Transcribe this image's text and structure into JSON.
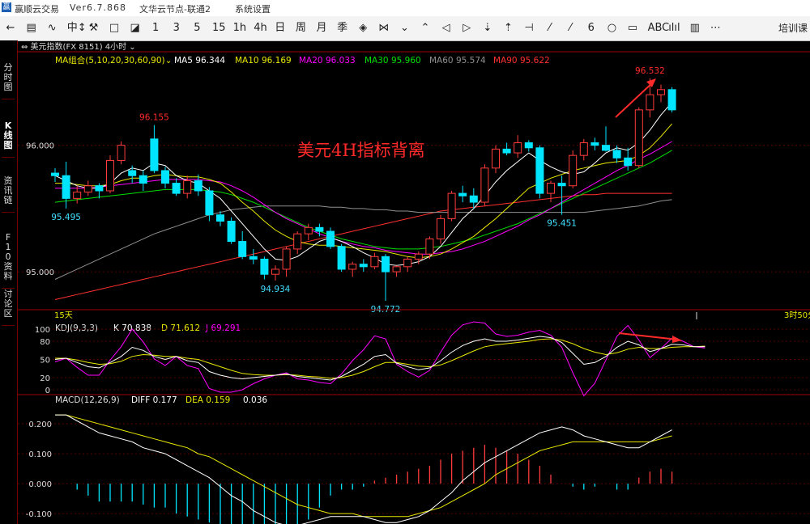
{
  "titlebar": {
    "app": "赢顺云交易",
    "version": "Ver6.7.868",
    "node": "文华云节点-联通2",
    "section": "系统设置"
  },
  "toolbar": {
    "items": [
      "←",
      "▤",
      "∿",
      "中↕",
      "⚒",
      "□",
      "◪",
      "1",
      "3",
      "5",
      "15",
      "1h",
      "4h",
      "日",
      "周",
      "月",
      "季",
      "◈",
      "⋈",
      "⌄",
      "⌃",
      "◁",
      "▷",
      "⇣",
      "⇡",
      "⊣",
      "⁄",
      "⁄",
      "6",
      "○",
      "▭",
      "ABC",
      "ılıl",
      "▥",
      "⋯"
    ],
    "training": "培训课"
  },
  "sidebar": {
    "tabs": [
      {
        "label": "分时图",
        "active": false
      },
      {
        "label": "K线图",
        "active": true
      },
      {
        "label": "资讯链",
        "active": false
      },
      {
        "label": "F10资料",
        "active": false
      },
      {
        "label": "讨论区",
        "active": false
      }
    ]
  },
  "colors": {
    "up": "#ff3c3c",
    "down": "#00e5ff",
    "ma5": "#ffffff",
    "ma10": "#e8e800",
    "ma20": "#ff00ff",
    "ma30": "#00e000",
    "ma60": "#909090",
    "ma90": "#ff3030",
    "k": "#ffffff",
    "d": "#e8e800",
    "j": "#ff00ff",
    "annotation": "#ff2a2a",
    "axis": "#a00000"
  },
  "chart_data": [
    {
      "type": "candlestick",
      "symbol_header": "美元指数(FX 8151)  4小时",
      "indicator_header": "MA组合(5,10,20,30,60,90)",
      "ma_legend": [
        {
          "name": "MA5",
          "value": "96.344"
        },
        {
          "name": "MA10",
          "value": "96.169"
        },
        {
          "name": "MA20",
          "value": "96.033"
        },
        {
          "name": "MA30",
          "value": "95.960"
        },
        {
          "name": "MA60",
          "value": "95.574"
        },
        {
          "name": "MA90",
          "value": "95.622"
        }
      ],
      "annotation": "美元4H指标背离",
      "y_ticks": [
        96.0,
        95.0
      ],
      "ylim": [
        94.7,
        96.65
      ],
      "price_labels": [
        {
          "text": "96.532",
          "index": 54
        },
        {
          "text": "96.155",
          "index": 9
        },
        {
          "text": "95.495",
          "index": 1
        },
        {
          "text": "94.934",
          "index": 20
        },
        {
          "text": "94.772",
          "index": 30
        },
        {
          "text": "95.451",
          "index": 46
        }
      ],
      "footer_left": "15天",
      "footer_right": "3时50分",
      "candles": [
        [
          95.78,
          95.82,
          95.71,
          95.76
        ],
        [
          95.76,
          95.87,
          95.5,
          95.58
        ],
        [
          95.58,
          95.68,
          95.54,
          95.63
        ],
        [
          95.63,
          95.72,
          95.6,
          95.68
        ],
        [
          95.68,
          95.7,
          95.58,
          95.64
        ],
        [
          95.64,
          95.92,
          95.62,
          95.88
        ],
        [
          95.88,
          96.03,
          95.85,
          96.0
        ],
        [
          95.8,
          95.84,
          95.7,
          95.76
        ],
        [
          95.76,
          95.8,
          95.64,
          95.7
        ],
        [
          96.05,
          96.16,
          95.78,
          95.8
        ],
        [
          95.8,
          95.83,
          95.66,
          95.7
        ],
        [
          95.7,
          95.74,
          95.6,
          95.62
        ],
        [
          95.62,
          95.76,
          95.58,
          95.72
        ],
        [
          95.72,
          95.77,
          95.6,
          95.64
        ],
        [
          95.64,
          95.67,
          95.4,
          95.45
        ],
        [
          95.45,
          95.48,
          95.36,
          95.4
        ],
        [
          95.4,
          95.43,
          95.22,
          95.24
        ],
        [
          95.24,
          95.32,
          95.1,
          95.12
        ],
        [
          95.12,
          95.18,
          95.06,
          95.1
        ],
        [
          95.1,
          95.12,
          94.94,
          94.98
        ],
        [
          94.98,
          95.05,
          94.93,
          95.02
        ],
        [
          95.02,
          95.2,
          94.96,
          95.18
        ],
        [
          95.18,
          95.32,
          95.14,
          95.3
        ],
        [
          95.3,
          95.38,
          95.25,
          95.35
        ],
        [
          95.35,
          95.38,
          95.28,
          95.32
        ],
        [
          95.32,
          95.35,
          95.18,
          95.2
        ],
        [
          95.2,
          95.22,
          95.0,
          95.02
        ],
        [
          95.02,
          95.08,
          94.96,
          95.06
        ],
        [
          95.06,
          95.1,
          95.0,
          95.04
        ],
        [
          95.04,
          95.15,
          95.02,
          95.12
        ],
        [
          95.12,
          95.14,
          94.77,
          95.0
        ],
        [
          95.0,
          95.05,
          94.96,
          95.04
        ],
        [
          95.04,
          95.12,
          95.0,
          95.1
        ],
        [
          95.1,
          95.16,
          95.06,
          95.14
        ],
        [
          95.14,
          95.28,
          95.1,
          95.26
        ],
        [
          95.26,
          95.45,
          95.22,
          95.42
        ],
        [
          95.42,
          95.64,
          95.4,
          95.62
        ],
        [
          95.62,
          95.68,
          95.55,
          95.6
        ],
        [
          95.6,
          95.66,
          95.5,
          95.55
        ],
        [
          95.55,
          95.85,
          95.52,
          95.82
        ],
        [
          95.82,
          96.0,
          95.78,
          95.97
        ],
        [
          95.97,
          96.02,
          95.92,
          95.94
        ],
        [
          95.94,
          96.08,
          95.9,
          96.02
        ],
        [
          96.02,
          96.04,
          95.95,
          95.98
        ],
        [
          95.98,
          96.0,
          95.58,
          95.62
        ],
        [
          95.62,
          95.72,
          95.55,
          95.7
        ],
        [
          95.7,
          95.76,
          95.45,
          95.68
        ],
        [
          95.68,
          95.96,
          95.66,
          95.92
        ],
        [
          95.92,
          96.05,
          95.88,
          96.02
        ],
        [
          96.02,
          96.06,
          95.96,
          96.0
        ],
        [
          96.0,
          96.15,
          95.95,
          95.96
        ],
        [
          95.96,
          96.0,
          95.86,
          95.9
        ],
        [
          95.9,
          95.98,
          95.8,
          95.84
        ],
        [
          95.84,
          96.3,
          95.82,
          96.28
        ],
        [
          96.28,
          96.53,
          96.22,
          96.4
        ],
        [
          96.4,
          96.48,
          96.34,
          96.44
        ],
        [
          96.44,
          96.46,
          96.26,
          96.28
        ]
      ],
      "ma_series": {
        "MA5": [
          95.76,
          95.72,
          95.68,
          95.66,
          95.66,
          95.7,
          95.78,
          95.82,
          95.8,
          95.86,
          95.84,
          95.76,
          95.72,
          95.7,
          95.64,
          95.58,
          95.48,
          95.38,
          95.28,
          95.18,
          95.1,
          95.09,
          95.12,
          95.18,
          95.24,
          95.27,
          95.24,
          95.2,
          95.15,
          95.11,
          95.06,
          95.05,
          95.06,
          95.08,
          95.12,
          95.2,
          95.31,
          95.42,
          95.5,
          95.6,
          95.71,
          95.8,
          95.87,
          95.94,
          95.88,
          95.83,
          95.79,
          95.77,
          95.79,
          95.86,
          95.94,
          95.98,
          95.96,
          96.02,
          96.12,
          96.24,
          96.34
        ],
        "MA10": [
          95.7,
          95.7,
          95.69,
          95.68,
          95.68,
          95.69,
          95.72,
          95.74,
          95.74,
          95.76,
          95.77,
          95.76,
          95.75,
          95.75,
          95.73,
          95.7,
          95.63,
          95.55,
          95.48,
          95.4,
          95.33,
          95.28,
          95.24,
          95.22,
          95.21,
          95.21,
          95.2,
          95.19,
          95.18,
          95.17,
          95.16,
          95.14,
          95.12,
          95.11,
          95.12,
          95.14,
          95.18,
          95.23,
          95.28,
          95.35,
          95.42,
          95.5,
          95.58,
          95.66,
          95.7,
          95.74,
          95.77,
          95.8,
          95.82,
          95.84,
          95.86,
          95.87,
          95.88,
          95.92,
          95.98,
          96.07,
          96.17
        ],
        "MA20": [
          95.66,
          95.66,
          95.66,
          95.66,
          95.67,
          95.68,
          95.69,
          95.7,
          95.71,
          95.72,
          95.73,
          95.73,
          95.73,
          95.73,
          95.72,
          95.71,
          95.68,
          95.64,
          95.59,
          95.53,
          95.47,
          95.42,
          95.38,
          95.34,
          95.3,
          95.27,
          95.24,
          95.22,
          95.2,
          95.19,
          95.17,
          95.16,
          95.15,
          95.14,
          95.14,
          95.15,
          95.16,
          95.18,
          95.21,
          95.24,
          95.28,
          95.32,
          95.36,
          95.41,
          95.45,
          95.5,
          95.55,
          95.6,
          95.65,
          95.7,
          95.75,
          95.8,
          95.84,
          95.89,
          95.93,
          95.98,
          96.03
        ],
        "MA30": [
          95.55,
          95.56,
          95.57,
          95.58,
          95.59,
          95.6,
          95.61,
          95.62,
          95.63,
          95.64,
          95.65,
          95.65,
          95.65,
          95.65,
          95.64,
          95.63,
          95.61,
          95.58,
          95.55,
          95.51,
          95.47,
          95.43,
          95.39,
          95.35,
          95.32,
          95.29,
          95.26,
          95.24,
          95.22,
          95.2,
          95.19,
          95.18,
          95.18,
          95.18,
          95.19,
          95.2,
          95.22,
          95.24,
          95.26,
          95.29,
          95.32,
          95.35,
          95.38,
          95.42,
          95.46,
          95.5,
          95.54,
          95.58,
          95.62,
          95.66,
          95.7,
          95.74,
          95.78,
          95.82,
          95.86,
          95.91,
          95.96
        ],
        "MA60": [
          94.94,
          94.98,
          95.02,
          95.06,
          95.1,
          95.14,
          95.18,
          95.22,
          95.26,
          95.3,
          95.33,
          95.36,
          95.39,
          95.42,
          95.45,
          95.47,
          95.49,
          95.5,
          95.51,
          95.52,
          95.52,
          95.52,
          95.52,
          95.52,
          95.52,
          95.51,
          95.51,
          95.5,
          95.5,
          95.49,
          95.49,
          95.48,
          95.48,
          95.47,
          95.47,
          95.47,
          95.47,
          95.47,
          95.47,
          95.47,
          95.47,
          95.47,
          95.47,
          95.47,
          95.47,
          95.47,
          95.47,
          95.47,
          95.47,
          95.48,
          95.49,
          95.5,
          95.51,
          95.52,
          95.54,
          95.56,
          95.57
        ],
        "MA90": [
          94.78,
          94.8,
          94.82,
          94.84,
          94.86,
          94.88,
          94.9,
          94.92,
          94.94,
          94.96,
          94.98,
          95.0,
          95.02,
          95.04,
          95.06,
          95.08,
          95.1,
          95.12,
          95.14,
          95.16,
          95.18,
          95.2,
          95.22,
          95.24,
          95.26,
          95.28,
          95.3,
          95.32,
          95.34,
          95.36,
          95.38,
          95.4,
          95.42,
          95.44,
          95.46,
          95.48,
          95.49,
          95.5,
          95.51,
          95.52,
          95.53,
          95.54,
          95.55,
          95.56,
          95.57,
          95.58,
          95.59,
          95.6,
          95.61,
          95.61,
          95.62,
          95.62,
          95.62,
          95.62,
          95.62,
          95.62,
          95.62
        ]
      }
    },
    {
      "type": "line",
      "header": "KDJ(9,3,3)",
      "legend": [
        {
          "name": "K",
          "value": "70.838"
        },
        {
          "name": "D",
          "value": "71.612"
        },
        {
          "name": "J",
          "value": "69.291"
        }
      ],
      "y_ticks": [
        100,
        80,
        50,
        20,
        0
      ],
      "ylim": [
        -8,
        112
      ],
      "series": {
        "K": [
          50,
          52,
          45,
          38,
          36,
          45,
          55,
          70,
          65,
          55,
          50,
          55,
          48,
          45,
          30,
          24,
          20,
          18,
          20,
          22,
          24,
          26,
          22,
          20,
          18,
          16,
          22,
          32,
          42,
          55,
          58,
          44,
          38,
          33,
          36,
          48,
          62,
          73,
          80,
          84,
          80,
          80,
          82,
          85,
          88,
          86,
          78,
          60,
          42,
          45,
          55,
          70,
          80,
          74,
          63,
          68,
          75,
          74,
          71,
          71
        ],
        "D": [
          52,
          52,
          49,
          45,
          42,
          43,
          47,
          55,
          58,
          57,
          55,
          55,
          52,
          50,
          44,
          38,
          32,
          27,
          25,
          24,
          24,
          25,
          24,
          22,
          21,
          19,
          20,
          24,
          30,
          38,
          45,
          45,
          42,
          39,
          38,
          41,
          48,
          56,
          64,
          71,
          74,
          76,
          78,
          80,
          83,
          84,
          82,
          76,
          68,
          62,
          58,
          61,
          67,
          70,
          68,
          68,
          70,
          71,
          71,
          72
        ],
        "J": [
          46,
          52,
          37,
          24,
          24,
          49,
          71,
          100,
          79,
          51,
          40,
          55,
          40,
          35,
          2,
          -4,
          -4,
          0,
          10,
          18,
          24,
          28,
          18,
          16,
          12,
          10,
          26,
          48,
          66,
          89,
          84,
          42,
          30,
          21,
          32,
          62,
          90,
          107,
          112,
          110,
          92,
          88,
          90,
          95,
          98,
          90,
          70,
          28,
          -10,
          11,
          49,
          88,
          106,
          82,
          53,
          68,
          85,
          80,
          71,
          69
        ]
      }
    },
    {
      "type": "bar",
      "header": "MACD(12,26,9)",
      "legend": [
        {
          "name": "DIFF",
          "value": "0.177"
        },
        {
          "name": "DEA",
          "value": "0.159"
        },
        {
          "name": "MACD",
          "value": "0.036"
        }
      ],
      "y_ticks": [
        "0.200",
        "0.100",
        "0.000",
        "-0.100"
      ],
      "y_tick_values": [
        0.2,
        0.1,
        0.0,
        -0.1
      ],
      "ylim": [
        -0.135,
        0.26
      ],
      "diff": [
        0.23,
        0.23,
        0.21,
        0.19,
        0.17,
        0.16,
        0.15,
        0.14,
        0.12,
        0.11,
        0.1,
        0.08,
        0.06,
        0.04,
        0.02,
        -0.01,
        -0.04,
        -0.06,
        -0.09,
        -0.11,
        -0.13,
        -0.14,
        -0.14,
        -0.13,
        -0.12,
        -0.11,
        -0.11,
        -0.11,
        -0.11,
        -0.12,
        -0.13,
        -0.13,
        -0.12,
        -0.11,
        -0.09,
        -0.06,
        -0.03,
        0.01,
        0.04,
        0.07,
        0.09,
        0.11,
        0.13,
        0.15,
        0.17,
        0.18,
        0.19,
        0.18,
        0.16,
        0.15,
        0.14,
        0.13,
        0.12,
        0.12,
        0.14,
        0.16,
        0.18
      ],
      "dea": [
        0.23,
        0.23,
        0.22,
        0.21,
        0.2,
        0.19,
        0.18,
        0.17,
        0.16,
        0.15,
        0.14,
        0.13,
        0.12,
        0.1,
        0.09,
        0.07,
        0.05,
        0.03,
        0.01,
        -0.01,
        -0.03,
        -0.05,
        -0.07,
        -0.08,
        -0.09,
        -0.1,
        -0.1,
        -0.1,
        -0.11,
        -0.11,
        -0.11,
        -0.11,
        -0.11,
        -0.1,
        -0.09,
        -0.08,
        -0.06,
        -0.04,
        -0.02,
        0.0,
        0.03,
        0.05,
        0.07,
        0.09,
        0.11,
        0.12,
        0.13,
        0.14,
        0.14,
        0.14,
        0.14,
        0.14,
        0.14,
        0.14,
        0.14,
        0.15,
        0.16
      ],
      "hist": [
        0.0,
        0.0,
        -0.02,
        -0.04,
        -0.06,
        -0.06,
        -0.06,
        -0.06,
        -0.07,
        -0.08,
        -0.08,
        -0.1,
        -0.11,
        -0.12,
        -0.13,
        -0.15,
        -0.17,
        -0.18,
        -0.19,
        -0.19,
        -0.2,
        -0.19,
        -0.16,
        -0.12,
        -0.08,
        -0.04,
        -0.02,
        -0.02,
        -0.01,
        0.01,
        0.02,
        0.03,
        0.04,
        0.05,
        0.06,
        0.08,
        0.1,
        0.11,
        0.12,
        0.13,
        0.12,
        0.11,
        0.1,
        0.08,
        0.06,
        0.03,
        0.0,
        -0.01,
        -0.02,
        -0.01,
        0.0,
        -0.02,
        -0.02,
        0.02,
        0.04,
        0.05,
        0.04
      ]
    }
  ]
}
